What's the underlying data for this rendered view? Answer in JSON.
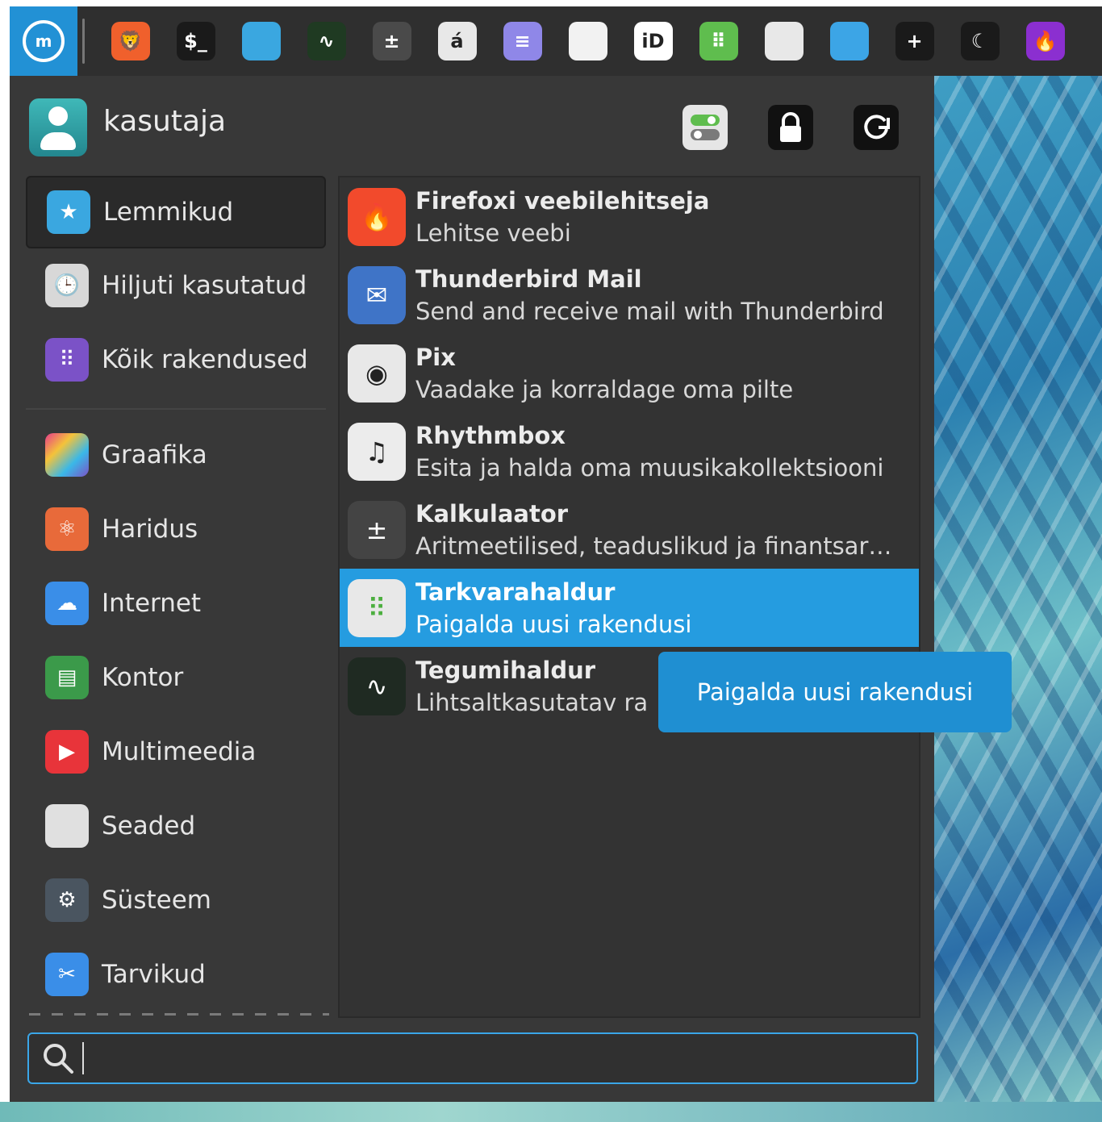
{
  "panel": {
    "start_label": "Menu",
    "launchers": [
      {
        "name": "brave-icon",
        "bg": "#f0602c",
        "glyph": "🦁"
      },
      {
        "name": "terminal-icon",
        "bg": "#1a1a1a",
        "glyph": "$_"
      },
      {
        "name": "files-icon",
        "bg": "#3aa7e0",
        "glyph": ""
      },
      {
        "name": "system-monitor-icon",
        "bg": "#1f3a22",
        "glyph": "∿"
      },
      {
        "name": "calculator-icon",
        "bg": "#4a4a4a",
        "glyph": "±"
      },
      {
        "name": "character-map-icon",
        "bg": "#e8e8e8",
        "glyph": "á"
      },
      {
        "name": "text-editor-icon",
        "bg": "#8f87e8",
        "glyph": "≡"
      },
      {
        "name": "document-viewer-icon",
        "bg": "#f2f2f2",
        "glyph": ""
      },
      {
        "name": "id-card-icon",
        "bg": "#ffffff",
        "glyph": "iD"
      },
      {
        "name": "software-manager-icon",
        "bg": "#5fbd4e",
        "glyph": "⠿"
      },
      {
        "name": "settings-icon",
        "bg": "#e8e8e8",
        "glyph": ""
      },
      {
        "name": "cast-icon",
        "bg": "#3ca5e6",
        "glyph": ""
      },
      {
        "name": "screenshot-icon",
        "bg": "#1a1a1a",
        "glyph": "+"
      },
      {
        "name": "night-light-icon",
        "bg": "#1a1a1a",
        "glyph": "☾"
      },
      {
        "name": "firefox-icon",
        "bg": "#8b2fd0",
        "glyph": "🔥"
      }
    ]
  },
  "user": {
    "name": "kasutaja"
  },
  "categories": [
    {
      "label": "Lemmikud",
      "icon": "favorites-folder-icon",
      "bg": "#3aa7e0",
      "glyph": "★",
      "selected": true
    },
    {
      "label": "Hiljuti kasutatud",
      "icon": "recent-clock-icon",
      "bg": "#d8d8d8",
      "glyph": "🕒"
    },
    {
      "label": "Kõik rakendused",
      "icon": "all-apps-grid-icon",
      "bg": "#7b52c7",
      "glyph": "⠿"
    },
    {
      "label": "Graafika",
      "icon": "graphics-icon",
      "bg": "#e0407a",
      "glyph": ""
    },
    {
      "label": "Haridus",
      "icon": "education-icon",
      "bg": "#e86a3a",
      "glyph": "⚛"
    },
    {
      "label": "Internet",
      "icon": "internet-cloud-icon",
      "bg": "#3a8ee8",
      "glyph": "☁"
    },
    {
      "label": "Kontor",
      "icon": "office-icon",
      "bg": "#3b9a4a",
      "glyph": "▤"
    },
    {
      "label": "Multimeedia",
      "icon": "multimedia-play-icon",
      "bg": "#e8343a",
      "glyph": "▶"
    },
    {
      "label": "Seaded",
      "icon": "settings-toggle-icon",
      "bg": "#e0e0e0",
      "glyph": ""
    },
    {
      "label": "Süsteem",
      "icon": "system-gear-icon",
      "bg": "#4a5560",
      "glyph": "⚙"
    },
    {
      "label": "Tarvikud",
      "icon": "accessories-scissors-icon",
      "bg": "#3a8ee8",
      "glyph": "✂"
    }
  ],
  "apps": [
    {
      "name": "Firefoxi veebilehitseja",
      "desc": "Lehitse veebi",
      "icon": "firefox-icon",
      "bg": "#f24a2c",
      "glyph": "🔥"
    },
    {
      "name": "Thunderbird Mail",
      "desc": "Send and receive mail with Thunderbird",
      "icon": "thunderbird-mail-icon",
      "bg": "#3f74c7",
      "glyph": "✉"
    },
    {
      "name": "Pix",
      "desc": "Vaadake ja korraldage oma pilte",
      "icon": "pix-icon",
      "bg": "#e8e8e8",
      "glyph": "◉"
    },
    {
      "name": "Rhythmbox",
      "desc": "Esita ja halda oma muusikakollektsiooni",
      "icon": "rhythmbox-icon",
      "bg": "#ececec",
      "glyph": "♫"
    },
    {
      "name": "Kalkulaator",
      "desc": "Aritmeetilised, teaduslikud ja finantsar…",
      "icon": "calculator-icon",
      "bg": "#444444",
      "glyph": "±"
    },
    {
      "name": "Tarkvarahaldur",
      "desc": "Paigalda uusi rakendusi",
      "icon": "software-manager-icon",
      "bg": "#e8e8e8",
      "glyph": "⠿",
      "selected": true
    },
    {
      "name": "Tegumihaldur",
      "desc": "Lihtsaltkasutatav ra",
      "icon": "task-manager-icon",
      "bg": "#1f2a22",
      "glyph": "∿"
    }
  ],
  "tooltip": {
    "text": "Paigalda uusi rakendusi"
  },
  "search": {
    "value": "",
    "placeholder": ""
  }
}
